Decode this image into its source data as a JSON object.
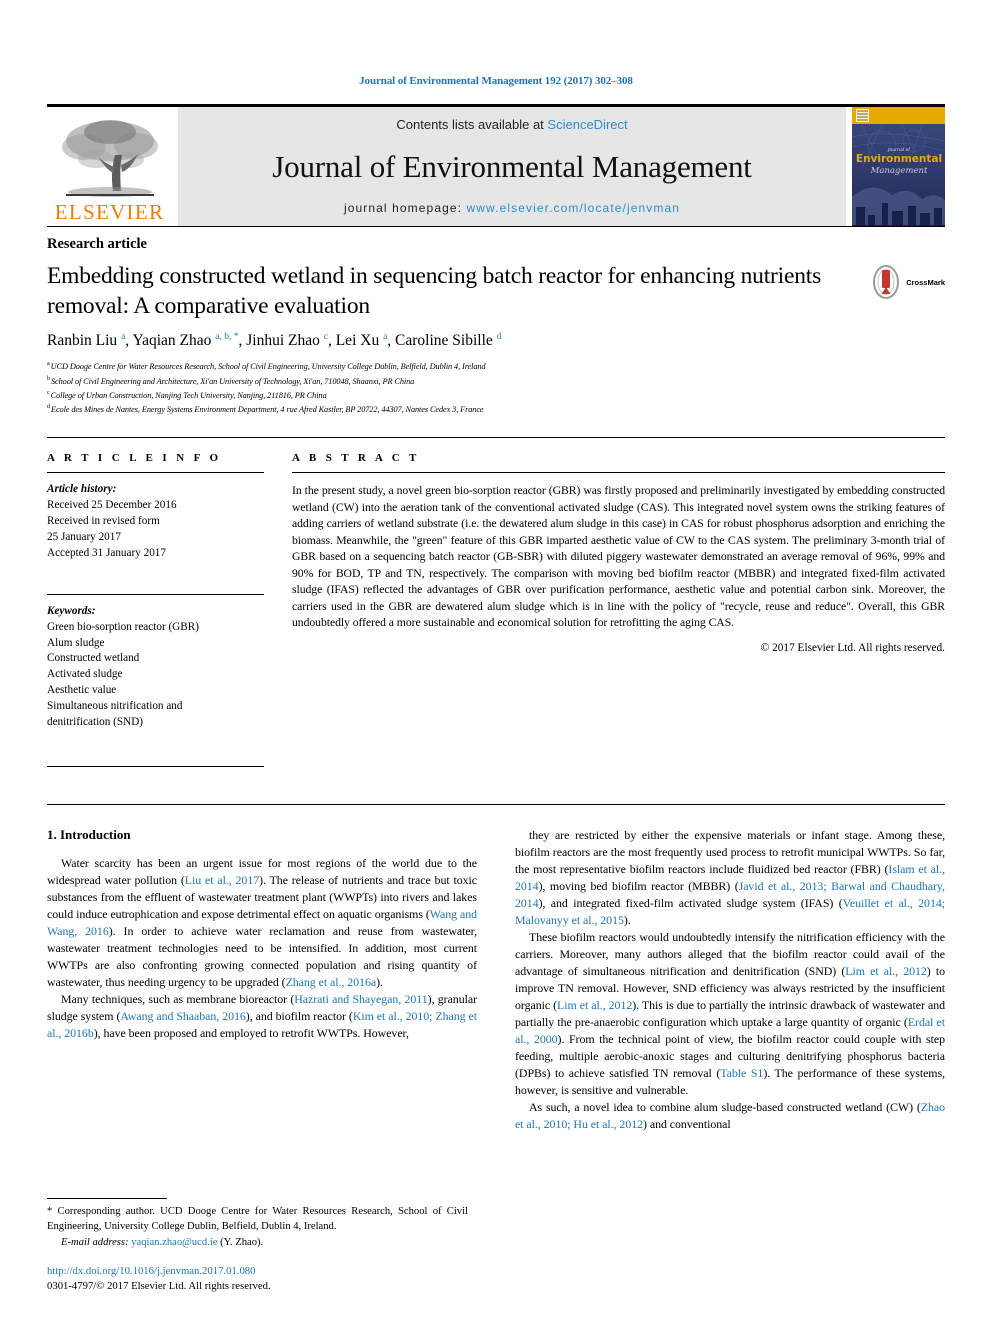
{
  "running_head": "Journal of Environmental Management 192 (2017) 302–308",
  "masthead": {
    "publisher_name": "ELSEVIER",
    "contents_prefix": "Contents lists available at",
    "contents_link": "ScienceDirect",
    "journal_title": "Journal of Environmental Management",
    "homepage_label": "journal homepage:",
    "homepage_url": "www.elsevier.com/locate/jenvman",
    "cover_line1": "Journal of",
    "cover_line2": "Environmental",
    "cover_line3": "Management",
    "link_color": "#2b8fd0"
  },
  "article": {
    "type_label": "Research article",
    "title": "Embedding constructed wetland in sequencing batch reactor for enhancing nutrients removal: A comparative evaluation",
    "crossmark_label": "CrossMark",
    "authors": [
      {
        "name": "Ranbin Liu",
        "sup": "a",
        "sep": ", "
      },
      {
        "name": "Yaqian Zhao",
        "sup": "a, b, *",
        "sep": ", "
      },
      {
        "name": "Jinhui Zhao",
        "sup": "c",
        "sep": ", "
      },
      {
        "name": "Lei Xu",
        "sup": "a",
        "sep": ", "
      },
      {
        "name": "Caroline Sibille",
        "sup": "d",
        "sep": ""
      }
    ],
    "affiliations": [
      {
        "sup": "a",
        "text": "UCD Dooge Centre for Water Resources Research, School of Civil Engineering, University College Dublin, Belfield, Dublin 4, Ireland"
      },
      {
        "sup": "b",
        "text": "School of Civil Engineering and Architecture, Xi'an University of Technology, Xi'an, 710048, Shaanxi, PR China"
      },
      {
        "sup": "c",
        "text": "College of Urban Construction, Nanjing Tech University, Nanjing, 211816, PR China"
      },
      {
        "sup": "d",
        "text": "Ecole des Mines de Nantes, Energy Systems Environment Department, 4 rue Afred Kastler, BP 20722, 44307, Nantes Cedex 3, France"
      }
    ]
  },
  "article_info": {
    "heading": "A R T I C L E   I N F O",
    "history_label": "Article history:",
    "history_lines": [
      "Received 25 December 2016",
      "Received in revised form",
      "25 January 2017",
      "Accepted 31 January 2017"
    ],
    "keywords_label": "Keywords:",
    "keywords": [
      "Green bio-sorption reactor (GBR)",
      "Alum sludge",
      "Constructed wetland",
      "Activated sludge",
      "Aesthetic value",
      "Simultaneous nitrification and",
      "denitrification (SND)"
    ]
  },
  "abstract": {
    "heading": "A B S T R A C T",
    "text": "In the present study, a novel green bio-sorption reactor (GBR) was firstly proposed and preliminarily investigated by embedding constructed wetland (CW) into the aeration tank of the conventional activated sludge (CAS). This integrated novel system owns the striking features of adding carriers of wetland substrate (i.e. the dewatered alum sludge in this case) in CAS for robust phosphorus adsorption and enriching the biomass. Meanwhile, the \"green\" feature of this GBR imparted aesthetic value of CW to the CAS system. The preliminary 3-month trial of GBR based on a sequencing batch reactor (GB-SBR) with diluted piggery wastewater demonstrated an average removal of 96%, 99% and 90% for BOD, TP and TN, respectively. The comparison with moving bed biofilm reactor (MBBR) and integrated fixed-film activated sludge (IFAS) reflected the advantages of GBR over purification performance, aesthetic value and potential carbon sink. Moreover, the carriers used in the GBR are dewatered alum sludge which is in line with the policy of \"recycle, reuse and reduce\". Overall, this GBR undoubtedly offered a more sustainable and economical solution for retrofitting the aging CAS.",
    "copyright": "© 2017 Elsevier Ltd. All rights reserved."
  },
  "body": {
    "section_heading": "1. Introduction",
    "left_paragraphs": [
      "Water scarcity has been an urgent issue for most regions of the world due to the widespread water pollution (<a class=\"ref\" href=\"#\" data-name=\"citation-link\" data-interactable=\"true\">Liu et al., 2017</a>). The release of nutrients and trace but toxic substances from the effluent of wastewater treatment plant (WWPTs) into rivers and lakes could induce eutrophication and expose detrimental effect on aquatic organisms (<a class=\"ref\" href=\"#\" data-name=\"citation-link\" data-interactable=\"true\">Wang and Wang, 2016</a>). In order to achieve water reclamation and reuse from wastewater, wastewater treatment technologies need to be intensified. In addition, most current WWTPs are also confronting growing connected population and rising quantity of wastewater, thus needing urgency to be upgraded (<a class=\"ref\" href=\"#\" data-name=\"citation-link\" data-interactable=\"true\">Zhang et al., 2016a</a>).",
      "Many techniques, such as membrane bioreactor (<a class=\"ref\" href=\"#\" data-name=\"citation-link\" data-interactable=\"true\">Hazrati and Shayegan, 2011</a>), granular sludge system (<a class=\"ref\" href=\"#\" data-name=\"citation-link\" data-interactable=\"true\">Awang and Shaaban, 2016</a>), and biofilm reactor (<a class=\"ref\" href=\"#\" data-name=\"citation-link\" data-interactable=\"true\">Kim et al., 2010; Zhang et al., 2016b</a>), have been proposed and employed to retrofit WWTPs. However,"
    ],
    "right_paragraphs": [
      "they are restricted by either the expensive materials or infant stage. Among these, biofilm reactors are the most frequently used process to retrofit municipal WWTPs. So far, the most representative biofilm reactors include fluidized bed reactor (FBR) (<a class=\"ref\" href=\"#\" data-name=\"citation-link\" data-interactable=\"true\">Islam et al., 2014</a>), moving bed biofilm reactor (MBBR) (<a class=\"ref\" href=\"#\" data-name=\"citation-link\" data-interactable=\"true\">Javid et al., 2013; Barwal and Chaudhary, 2014</a>), and integrated fixed-film activated sludge system (IFAS) (<a class=\"ref\" href=\"#\" data-name=\"citation-link\" data-interactable=\"true\">Veuillet et al., 2014; Malovanyy et al., 2015</a>).",
      "These biofilm reactors would undoubtedly intensify the nitrification efficiency with the carriers. Moreover, many authors alleged that the biofilm reactor could avail of the advantage of simultaneous nitrification and denitrification (SND) (<a class=\"ref\" href=\"#\" data-name=\"citation-link\" data-interactable=\"true\">Lim et al., 2012</a>) to improve TN removal. However, SND efficiency was always restricted by the insufficient organic (<a class=\"ref\" href=\"#\" data-name=\"citation-link\" data-interactable=\"true\">Lim et al., 2012</a>). This is due to partially the intrinsic drawback of wastewater and partially the pre-anaerobic configuration which uptake a large quantity of organic (<a class=\"ref\" href=\"#\" data-name=\"citation-link\" data-interactable=\"true\">Erdal et al., 2000</a>). From the technical point of view, the biofilm reactor could couple with step feeding, multiple aerobic-anoxic stages and culturing denitrifying phosphorus bacteria (DPBs) to achieve satisfied TN removal (<a class=\"ref\" href=\"#\" data-name=\"citation-link\" data-interactable=\"true\">Table S1</a>). The performance of these systems, however, is sensitive and vulnerable.",
      "As such, a novel idea to combine alum sludge-based constructed wetland (CW) (<a class=\"ref\" href=\"#\" data-name=\"citation-link\" data-interactable=\"true\">Zhao et al., 2010; Hu et al., 2012</a>) and conventional"
    ]
  },
  "footnote": {
    "corresponding": "* Corresponding author. UCD Dooge Centre for Water Resources Research, School of Civil Engineering, University College Dublin, Belfield, Dublin 4, Ireland.",
    "email_label": "E-mail address:",
    "email": "yaqian.zhao@ucd.ie",
    "email_suffix": "(Y. Zhao).",
    "doi": "http://dx.doi.org/10.1016/j.jenvman.2017.01.080",
    "issn_line": "0301-4797/© 2017 Elsevier Ltd. All rights reserved."
  }
}
